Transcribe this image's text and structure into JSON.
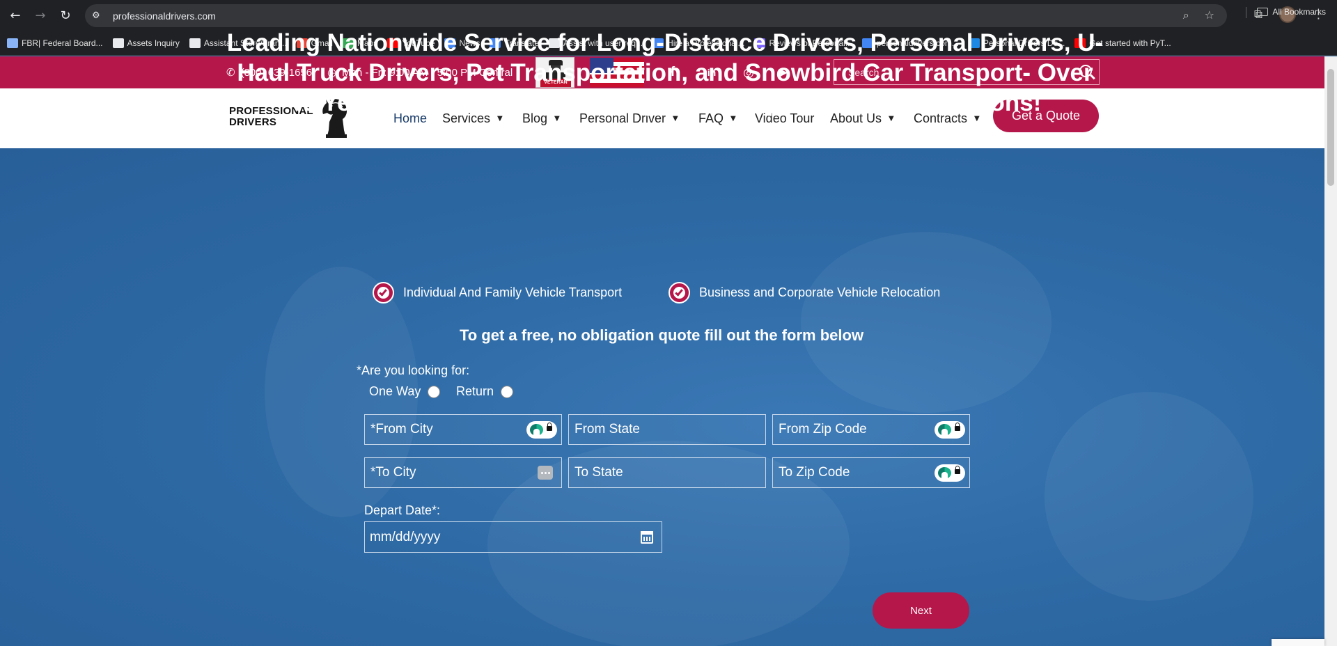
{
  "browser": {
    "url": "professionaldrivers.com",
    "bookmarks": [
      {
        "label": "FBR| Federal Board...",
        "color": "#8ab4f8"
      },
      {
        "label": "Assets Inquiry",
        "color": "#e8eaed"
      },
      {
        "label": "Assistant Store/Fran...",
        "color": "#e8eaed"
      },
      {
        "label": "Gmail",
        "color": "#ea4335"
      },
      {
        "label": "Maps",
        "color": "#34a853"
      },
      {
        "label": "YouTube",
        "color": "#ff0000"
      },
      {
        "label": "News",
        "color": "#4285f4"
      },
      {
        "label": "Translate",
        "color": "#4285f4"
      },
      {
        "label": "Assist with user req...",
        "color": "#e8eaed"
      },
      {
        "label": "Hire a Professional...",
        "color": "#4285f4"
      },
      {
        "label": "Reviews of Personal...",
        "color": "#7b61ff"
      },
      {
        "label": "personaldrivers.com...",
        "color": "#4285f4"
      },
      {
        "label": "Personal Drivers Do...",
        "color": "#1e88e5"
      },
      {
        "label": "Get started with PyT...",
        "color": "#ff0000"
      }
    ],
    "all_bookmarks": "All Bookmarks"
  },
  "topbar": {
    "phone": "(800) 639-1656",
    "hours": "Mon - Fri: 9:00 AM - 5:00 PM Central",
    "veteran_badge": "VETERAN OWNED",
    "social": [
      "f",
      "in",
      "◎",
      "▶"
    ],
    "search_placeholder": "Search"
  },
  "logo": {
    "line1": "PROFESSIONAL",
    "line2": "DRIVERS"
  },
  "nav": {
    "items": [
      {
        "label": "Home",
        "dropdown": false
      },
      {
        "label": "Services",
        "dropdown": true
      },
      {
        "label": "Blog",
        "dropdown": true
      },
      {
        "label": "Personal Driver",
        "dropdown": true
      },
      {
        "label": "FAQ",
        "dropdown": true
      },
      {
        "label": "Video Tour",
        "dropdown": false
      },
      {
        "label": "About Us",
        "dropdown": true
      },
      {
        "label": "Contracts",
        "dropdown": true
      }
    ],
    "cta": "Get a Quote"
  },
  "hero": {
    "title": "Leading Nationwide Service for Long-Distance Drivers, Personal Drivers, U-Haul Truck Drivers, Pet Transportation, and Snowbird Car Transport- Over 40 Years in Business, Providing Real People with Real Solutions!",
    "features": [
      "Individual And Family Vehicle Transport",
      "Business and Corporate Vehicle Relocation"
    ],
    "subtitle": "To get a free, no obligation quote fill out the form below"
  },
  "form": {
    "question": "*Are you looking for:",
    "options": [
      "One Way",
      "Return"
    ],
    "from_city": "*From City",
    "from_state": "From State",
    "from_zip": "From Zip Code",
    "to_city": "*To City",
    "to_state": "To State",
    "to_zip": "To Zip Code",
    "depart_label": "Depart Date*:",
    "depart_placeholder": "mm/dd/yyyy",
    "next": "Next"
  },
  "colors": {
    "brand_crimson": "#b5174b",
    "hero_blue": "#2f6aa6",
    "nav_active": "#163968"
  }
}
